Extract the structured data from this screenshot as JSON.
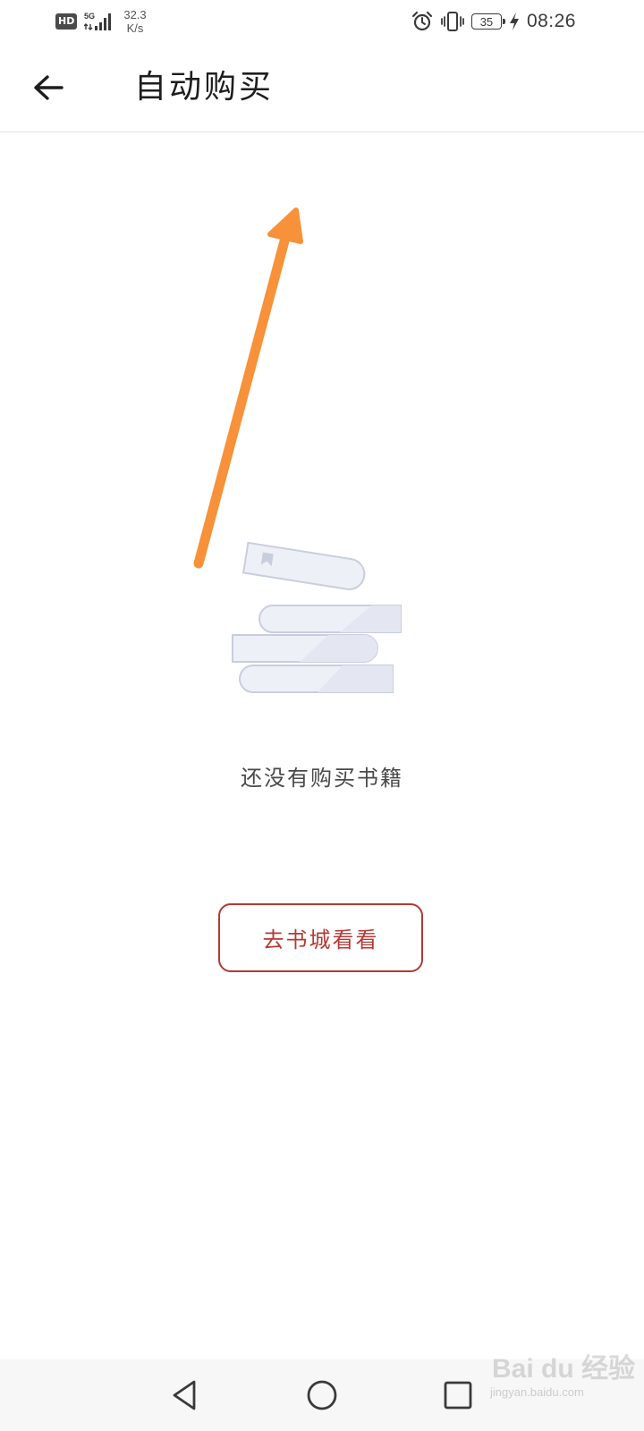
{
  "status_bar": {
    "network_badge": "HD",
    "network_type": "5G",
    "speed_value": "32.3",
    "speed_unit": "K/s",
    "battery_level": "35",
    "time": "08:26",
    "icons": [
      "alarm-icon",
      "vibrate-icon",
      "battery-icon",
      "charging-icon"
    ]
  },
  "header": {
    "title": "自动购买",
    "back_icon": "back-arrow-icon"
  },
  "empty_state": {
    "illustration": "stacked-books-icon",
    "message": "还没有购买书籍",
    "button_label": "去书城看看"
  },
  "annotation": {
    "type": "arrow",
    "color": "#F7913A"
  },
  "navigation_bar": {
    "buttons": [
      "back-triangle-icon",
      "home-circle-icon",
      "recents-square-icon"
    ]
  },
  "watermark": {
    "brand": "Bai du 经验",
    "url": "jingyan.baidu.com"
  },
  "colors": {
    "accent": "#B33A35",
    "illustration_fill": "#EEF0F8",
    "illustration_stroke": "#C9CEDD"
  }
}
